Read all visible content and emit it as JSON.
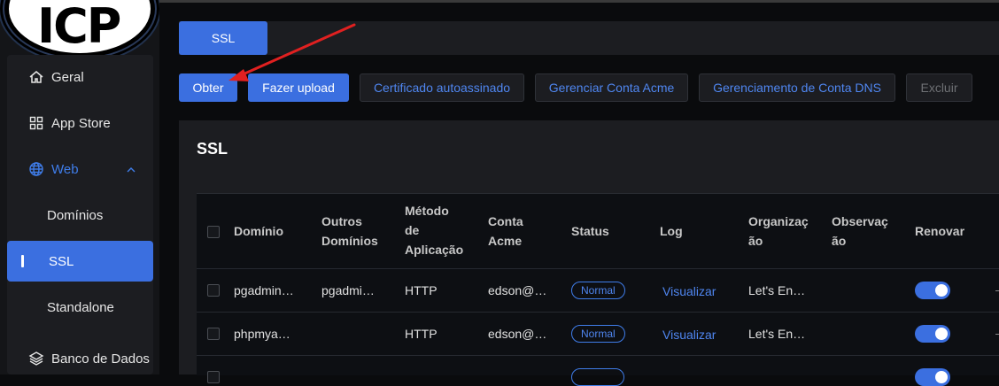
{
  "logo": {
    "text": "ICP"
  },
  "sidebar": {
    "items": [
      {
        "label": "Geral",
        "icon": "home-icon"
      },
      {
        "label": "App Store",
        "icon": "grid-icon"
      },
      {
        "label": "Web",
        "icon": "globe-icon"
      },
      {
        "label": "Domínios"
      },
      {
        "label": "SSL"
      },
      {
        "label": "Standalone"
      },
      {
        "label": "Banco de Dados",
        "icon": "layers-icon"
      }
    ]
  },
  "tabs": {
    "active": "SSL"
  },
  "toolbar": {
    "obter": "Obter",
    "upload": "Fazer upload",
    "selfsigned": "Certificado autoassinado",
    "acme": "Gerenciar Conta Acme",
    "dns": "Gerenciamento de Conta DNS",
    "delete": "Excluir"
  },
  "card": {
    "title": "SSL"
  },
  "table": {
    "headers": {
      "domain": "Domínio",
      "others_1": "Outros",
      "others_2": "Domínios",
      "method_1": "Método",
      "method_2": "de",
      "method_3": "Aplicação",
      "acme_1": "Conta",
      "acme_2": "Acme",
      "status": "Status",
      "log": "Log",
      "org_1": "Organizaç",
      "org_2": "ão",
      "obs_1": "Observaç",
      "obs_2": "ão",
      "renew": "Renovar"
    },
    "rows": [
      {
        "domain": "pgadmin…",
        "others": "pgadmi…",
        "method": "HTTP",
        "acme": "edson@…",
        "status": "Normal",
        "log": "Visualizar",
        "org": "Let's En…",
        "renew": true
      },
      {
        "domain": "phpmya…",
        "others": "",
        "method": "HTTP",
        "acme": "edson@…",
        "status": "Normal",
        "log": "Visualizar",
        "org": "Let's En…",
        "renew": true
      }
    ]
  },
  "colors": {
    "accent": "#3b6fe0",
    "link": "#4f86f0",
    "annotation_arrow": "#e02020"
  }
}
